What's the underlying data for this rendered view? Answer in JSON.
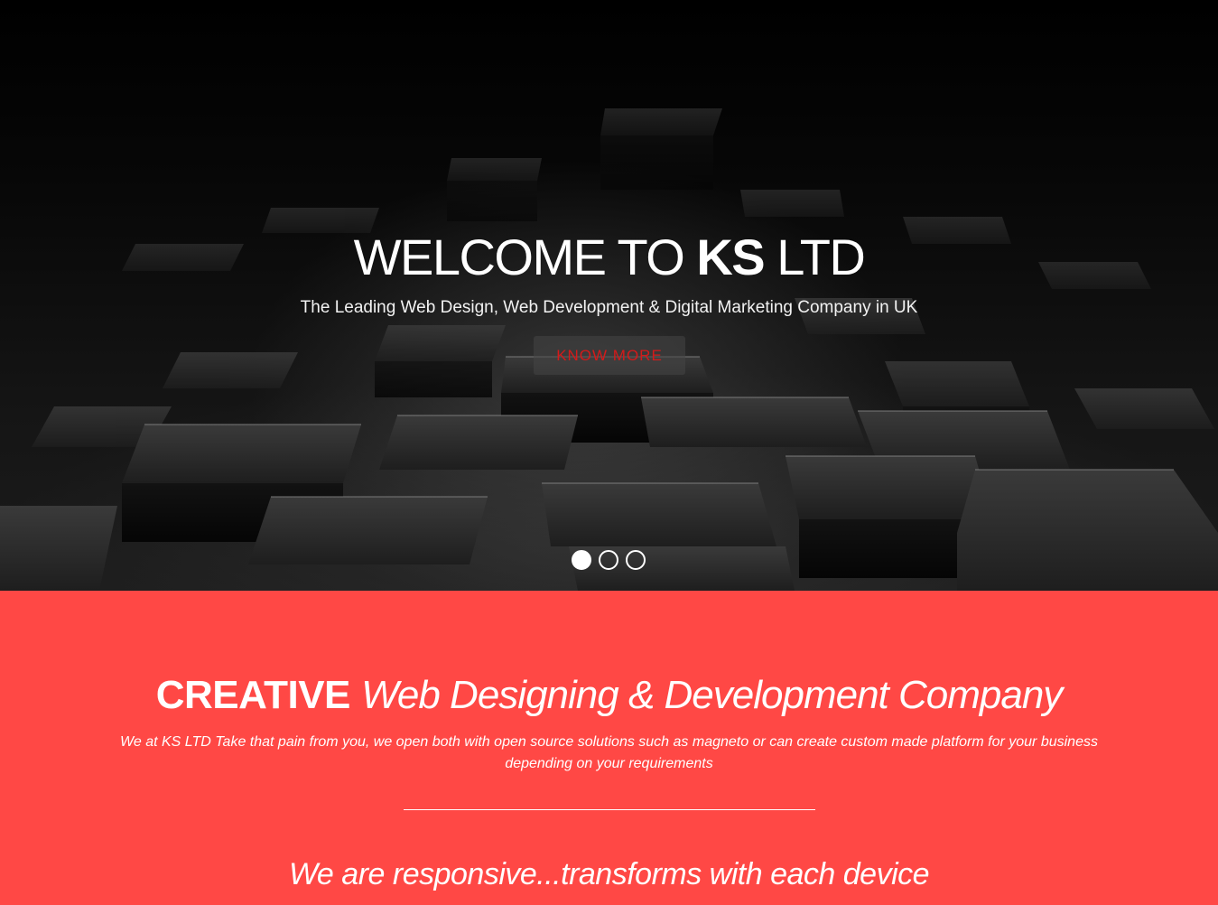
{
  "hero": {
    "title_prefix": "WELCOME TO ",
    "title_brand": "KS",
    "title_suffix": " LTD",
    "subtitle": "The Leading Web Design, Web Development & Digital Marketing Company in UK",
    "cta_label": "KNOW MORE",
    "slides": [
      {
        "active": true
      },
      {
        "active": false
      },
      {
        "active": false
      }
    ]
  },
  "feature": {
    "heading_strong": "CREATIVE",
    "heading_rest": "Web Designing & Development Company",
    "description": "We at KS LTD Take that pain from you, we open both with open source solutions such as magneto or can create custom made platform for your business depending on your requirements",
    "tagline": "We are responsive...transforms with each device"
  },
  "colors": {
    "accent_red": "#ff4845",
    "cta_text": "#d41a1a",
    "hero_bg": "#000000",
    "text": "#ffffff"
  }
}
